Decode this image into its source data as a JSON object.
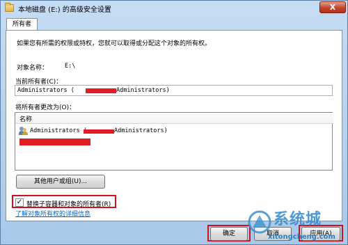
{
  "window": {
    "title": "本地磁盘 (E:) 的高级安全设置",
    "close_label": "X"
  },
  "tab": {
    "label": "所有者"
  },
  "panel": {
    "description": "如果您有所需的权限或特权，您就可以取得或分配这个对象的所有权。",
    "object_name_label": "对象名称：",
    "object_name_value": "E:\\",
    "current_owner_label": "当前所有者(C)：",
    "current_owner_prefix": "Administrators (",
    "current_owner_suffix": "Administrators)",
    "change_owner_label": "将所有者更改为(O)：",
    "list_column": "名称",
    "list_row_prefix": "Administrators (",
    "list_row_suffix": "Administrators)",
    "other_users_button": "其他用户或组(U)...",
    "replace_checkbox_label": "替换子容器和对象的所有者(R)",
    "replace_checked": true,
    "learn_more_link": "了解对象所有权的详细信息"
  },
  "footer": {
    "ok_button": "确定",
    "cancel_button": "取消",
    "apply_button": "应用(A)"
  },
  "watermark": {
    "text": "系统城",
    "url": "xitongcheng.com"
  },
  "colors": {
    "highlight_red": "#d0101c",
    "redact_red": "#e11c24",
    "link_blue": "#0066cc"
  }
}
